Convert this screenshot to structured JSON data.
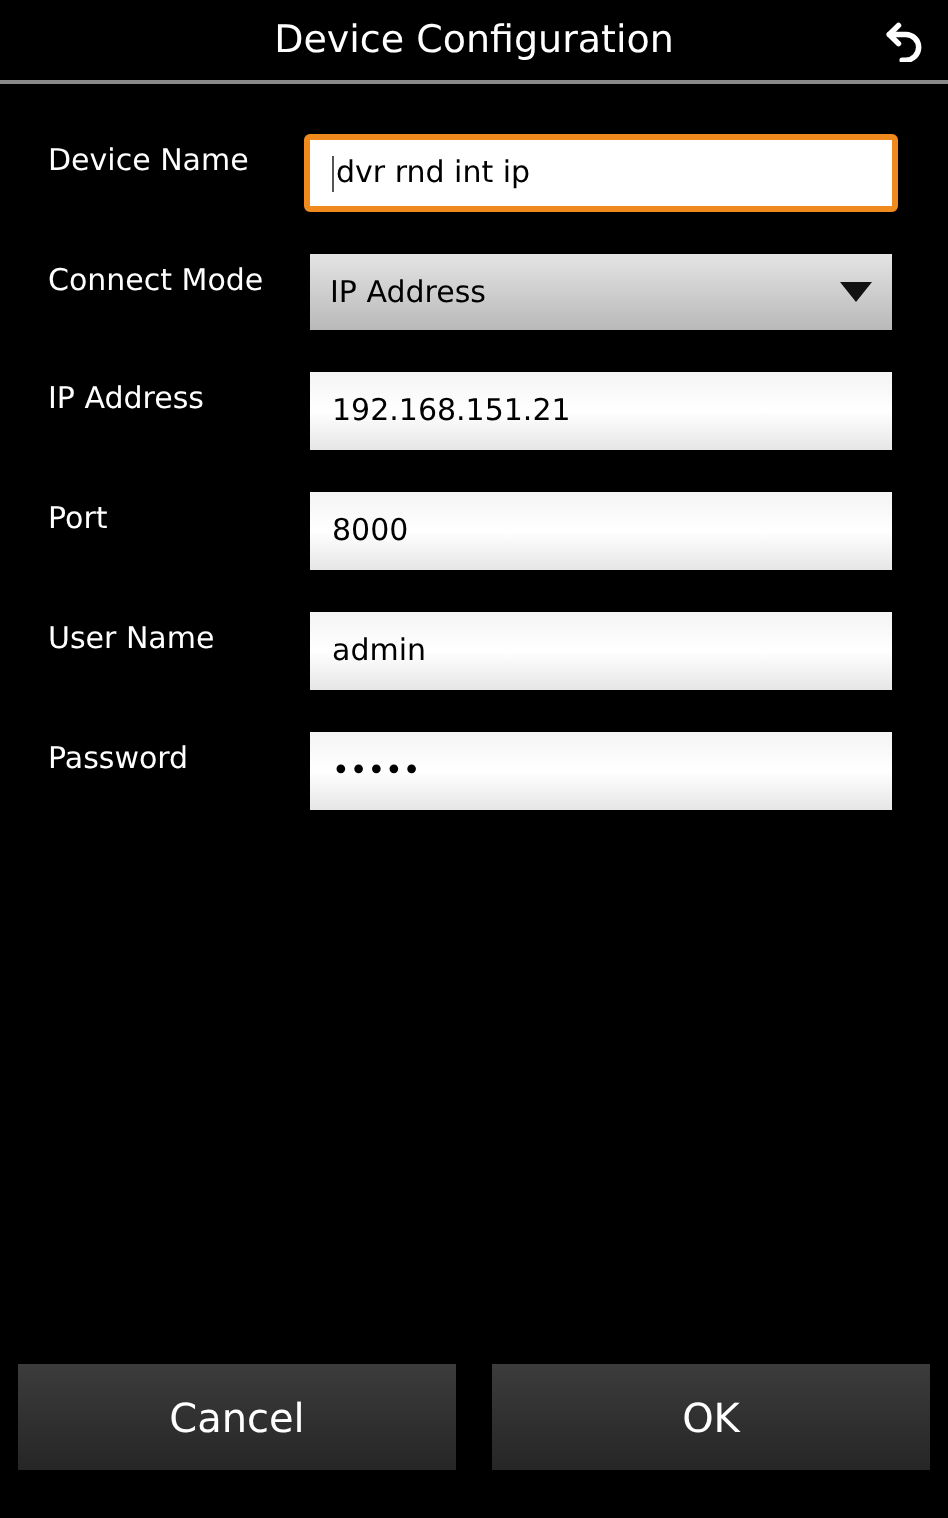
{
  "header": {
    "title": "Device Configuration"
  },
  "fields": [
    {
      "kind": "text",
      "label": "Device Name",
      "value": "dvr rnd int ip",
      "focused": true
    },
    {
      "kind": "dropdown",
      "label": "Connect Mode",
      "value": "IP Address",
      "focused": false
    },
    {
      "kind": "text",
      "label": "IP Address",
      "value": "192.168.151.21",
      "focused": false
    },
    {
      "kind": "text",
      "label": "Port",
      "value": "8000",
      "focused": false
    },
    {
      "kind": "text",
      "label": "User Name",
      "value": "admin",
      "focused": false
    },
    {
      "kind": "text",
      "label": "Password",
      "value": "•••••",
      "focused": false
    }
  ],
  "buttons": [
    "Cancel",
    "OK"
  ]
}
